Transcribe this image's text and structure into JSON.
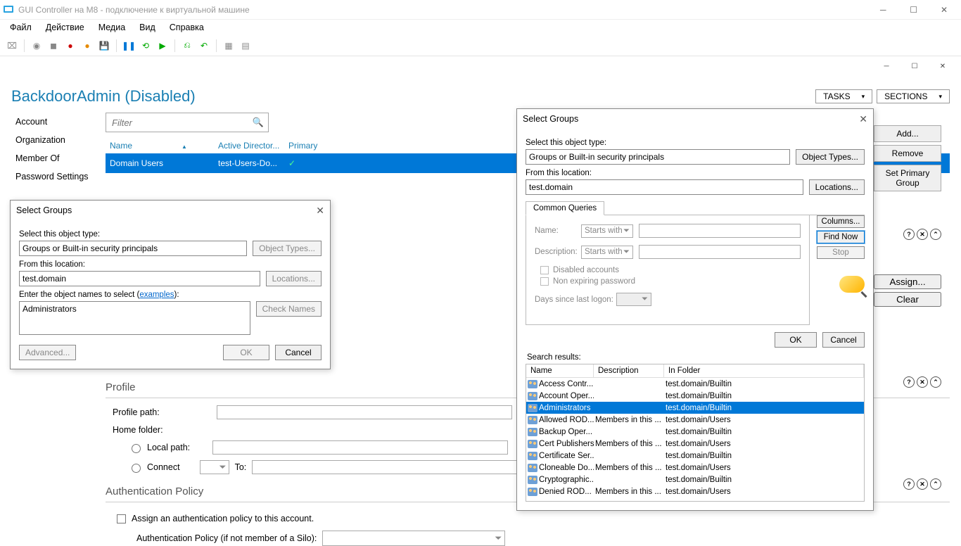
{
  "vm": {
    "title": "GUI Controller на M8 - подключение к виртуальной машине",
    "menu": [
      "Файл",
      "Действие",
      "Медиа",
      "Вид",
      "Справка"
    ]
  },
  "header": {
    "title": "BackdoorAdmin (Disabled)",
    "tasks": "TASKS",
    "sections": "SECTIONS"
  },
  "sidebar": {
    "items": [
      "Account",
      "Organization",
      "Member Of",
      "Password Settings"
    ]
  },
  "filter": {
    "placeholder": "Filter"
  },
  "grid": {
    "cols": {
      "name": "Name",
      "ad": "Active Director...",
      "primary": "Primary"
    },
    "row": {
      "name": "Domain Users",
      "ad": "test-Users-Do...",
      "primary": "✓"
    }
  },
  "right_btns": {
    "add": "Add...",
    "remove": "Remove",
    "set_primary": "Set Primary Group"
  },
  "assign_btns": {
    "assign": "Assign...",
    "clear": "Clear"
  },
  "profile": {
    "title": "Profile",
    "path": "Profile path:",
    "home": "Home folder:",
    "local": "Local path:",
    "connect": "Connect",
    "to": "To:"
  },
  "auth": {
    "title": "Authentication Policy",
    "assign": "Assign an authentication policy to this account.",
    "policy": "Authentication Policy (if not member of a Silo):"
  },
  "dlg1": {
    "title": "Select Groups",
    "obj_type_lbl": "Select this object type:",
    "obj_type": "Groups or Built-in security principals",
    "obj_btn": "Object Types...",
    "loc_lbl": "From this location:",
    "loc": "test.domain",
    "loc_btn": "Locations...",
    "names_lbl": "Enter the object names to select (",
    "examples": "examples",
    "names_lbl2": "):",
    "names_val": "Administrators",
    "check": "Check Names",
    "advanced": "Advanced...",
    "ok": "OK",
    "cancel": "Cancel"
  },
  "dlg2": {
    "title": "Select Groups",
    "obj_type_lbl": "Select this object type:",
    "obj_type": "Groups or Built-in security principals",
    "obj_btn": "Object Types...",
    "loc_lbl": "From this location:",
    "loc": "test.domain",
    "loc_btn": "Locations...",
    "tab": "Common Queries",
    "name_lbl": "Name:",
    "starts": "Starts with",
    "desc_lbl": "Description:",
    "disabled": "Disabled accounts",
    "nonexp": "Non expiring password",
    "days": "Days since last logon:",
    "columns": "Columns...",
    "find": "Find Now",
    "stop": "Stop",
    "ok": "OK",
    "cancel": "Cancel",
    "results_lbl": "Search results:",
    "cols": {
      "name": "Name",
      "desc": "Description",
      "folder": "In Folder"
    },
    "rows": [
      {
        "name": "Access Contr...",
        "desc": "",
        "folder": "test.domain/Builtin"
      },
      {
        "name": "Account Oper...",
        "desc": "",
        "folder": "test.domain/Builtin"
      },
      {
        "name": "Administrators",
        "desc": "",
        "folder": "test.domain/Builtin",
        "selected": true
      },
      {
        "name": "Allowed ROD...",
        "desc": "Members in this ...",
        "folder": "test.domain/Users"
      },
      {
        "name": "Backup Oper...",
        "desc": "",
        "folder": "test.domain/Builtin"
      },
      {
        "name": "Cert Publishers",
        "desc": "Members of this ...",
        "folder": "test.domain/Users"
      },
      {
        "name": "Certificate Ser...",
        "desc": "",
        "folder": "test.domain/Builtin"
      },
      {
        "name": "Cloneable Do...",
        "desc": "Members of this ...",
        "folder": "test.domain/Users"
      },
      {
        "name": "Cryptographic...",
        "desc": "",
        "folder": "test.domain/Builtin"
      },
      {
        "name": "Denied ROD...",
        "desc": "Members in this ...",
        "folder": "test.domain/Users"
      }
    ]
  }
}
